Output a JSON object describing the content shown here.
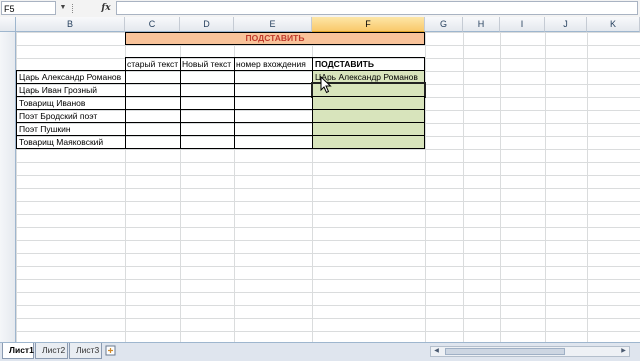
{
  "formula_bar": {
    "name_box": "F5",
    "fx_label": "fx",
    "formula": ""
  },
  "columns": [
    {
      "id": "B",
      "label": "B"
    },
    {
      "id": "C",
      "label": "C"
    },
    {
      "id": "D",
      "label": "D"
    },
    {
      "id": "E",
      "label": "E"
    },
    {
      "id": "F",
      "label": "F"
    },
    {
      "id": "G",
      "label": "G"
    },
    {
      "id": "H",
      "label": "H"
    },
    {
      "id": "I",
      "label": "I"
    },
    {
      "id": "J",
      "label": "J"
    },
    {
      "id": "K",
      "label": "K"
    }
  ],
  "sheet": {
    "banner": "ПОДСТАВИТЬ",
    "headers": {
      "c": "старый текст",
      "d": "Новый текст",
      "e": "номер вхождения",
      "f": "ПОДСТАВИТЬ"
    },
    "rows": [
      {
        "b": "Царь Александр Романов",
        "f": "ЦАрь Александр Романов"
      },
      {
        "b": "Царь Иван Грозный",
        "f": ""
      },
      {
        "b": "Товарищ Иванов",
        "f": ""
      },
      {
        "b": "Поэт Бродский поэт",
        "f": ""
      },
      {
        "b": "Поэт Пушкин",
        "f": ""
      },
      {
        "b": "Товарищ Маяковский",
        "f": ""
      }
    ]
  },
  "tabs": [
    {
      "label": "Лист1",
      "active": true
    },
    {
      "label": "Лист2",
      "active": false
    },
    {
      "label": "Лист3",
      "active": false
    }
  ],
  "colors": {
    "banner_fill": "#f9c39a",
    "banner_text": "#c0392b",
    "result_fill": "#d8e4bc",
    "active_header": "#f9c96b"
  }
}
